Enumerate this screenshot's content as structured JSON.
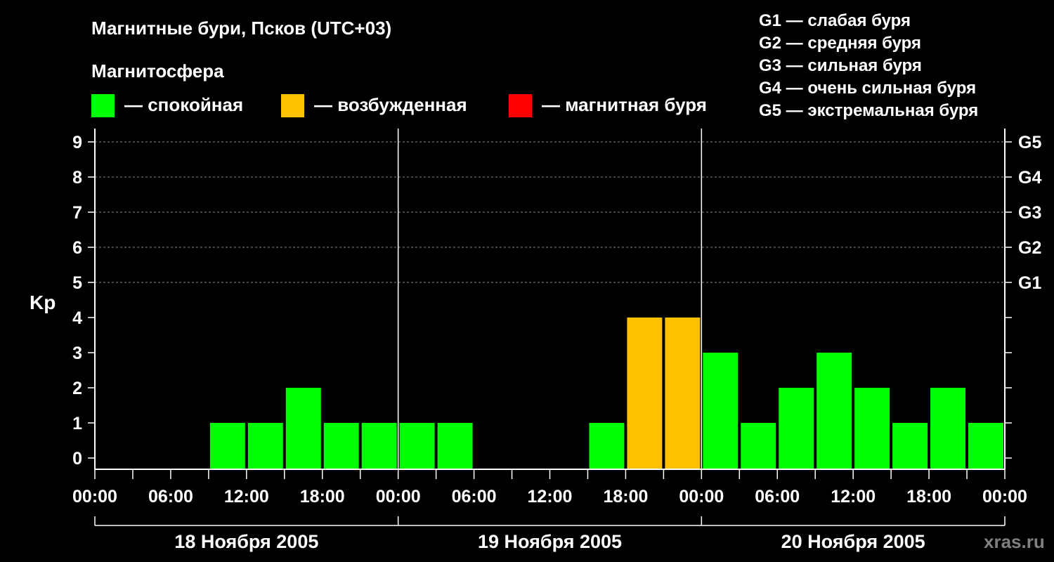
{
  "title": "Магнитные бури, Псков (UTC+03)",
  "legend": {
    "heading": "Магнитосфера",
    "items": [
      {
        "label": "— спокойная",
        "color": "#00ff00"
      },
      {
        "label": "— возбужденная",
        "color": "#ffc000"
      },
      {
        "label": "— магнитная буря",
        "color": "#ff0000"
      }
    ]
  },
  "g_scale": [
    "G1 — слабая буря",
    "G2 — средняя буря",
    "G3 — сильная буря",
    "G4 — очень сильная буря",
    "G5 — экстремальная буря"
  ],
  "watermark": "xras.ru",
  "chart_data": {
    "type": "bar",
    "title": "Магнитные бури, Псков (UTC+03)",
    "ylabel": "Kp",
    "xlabel": "",
    "ylim": [
      0,
      9
    ],
    "y_ticks": [
      "0",
      "1",
      "2",
      "3",
      "4",
      "5",
      "6",
      "7",
      "8",
      "9"
    ],
    "right_ticks": [
      {
        "value": 5,
        "label": "G1"
      },
      {
        "value": 6,
        "label": "G2"
      },
      {
        "value": 7,
        "label": "G3"
      },
      {
        "value": 8,
        "label": "G4"
      },
      {
        "value": 9,
        "label": "G5"
      }
    ],
    "x_tick_labels": [
      "00:00",
      "06:00",
      "12:00",
      "18:00",
      "00:00",
      "06:00",
      "12:00",
      "18:00",
      "00:00",
      "06:00",
      "12:00",
      "18:00",
      "00:00"
    ],
    "days": [
      "18 Ноября 2005",
      "19 Ноября 2005",
      "20 Ноября 2005"
    ],
    "interval_hours": 3,
    "grid": true,
    "values": [
      0,
      0,
      0,
      1,
      1,
      2,
      1,
      1,
      1,
      1,
      0,
      0,
      0,
      1,
      4,
      4,
      3,
      1,
      2,
      3,
      2,
      1,
      2,
      1
    ],
    "colors": {
      "quiet": "#00ff00",
      "active": "#ffc000",
      "storm": "#ff0000"
    }
  }
}
